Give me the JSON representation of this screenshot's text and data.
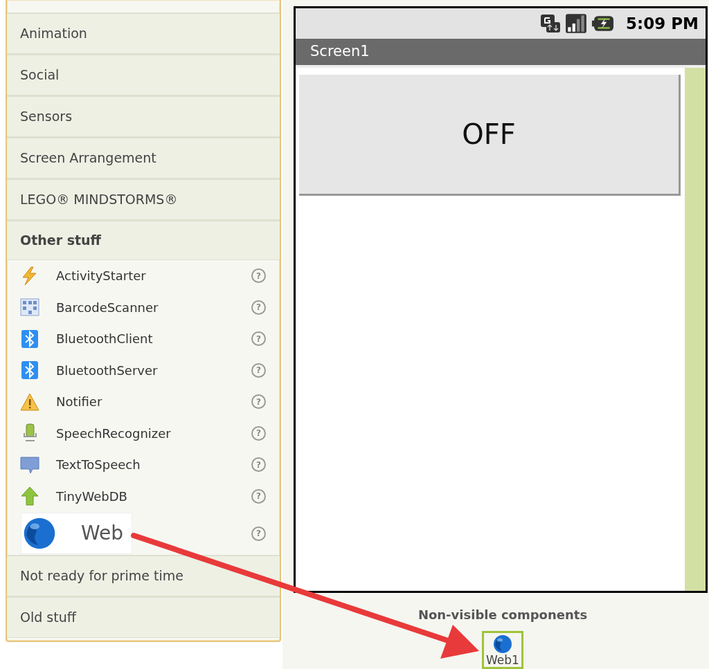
{
  "palette": {
    "categories": [
      {
        "label": "Animation",
        "expanded": false
      },
      {
        "label": "Social",
        "expanded": false
      },
      {
        "label": "Sensors",
        "expanded": false
      },
      {
        "label": "Screen Arrangement",
        "expanded": false
      },
      {
        "label": "LEGO® MINDSTORMS®",
        "expanded": false
      },
      {
        "label": "Other stuff",
        "expanded": true,
        "items": [
          {
            "kind": "bolt",
            "label": "ActivityStarter",
            "help": "?",
            "highlighted": false
          },
          {
            "kind": "grid",
            "label": "BarcodeScanner",
            "help": "?",
            "highlighted": false
          },
          {
            "kind": "bluetooth",
            "label": "BluetoothClient",
            "help": "?",
            "highlighted": false
          },
          {
            "kind": "bluetooth",
            "label": "BluetoothServer",
            "help": "?",
            "highlighted": false
          },
          {
            "kind": "warning",
            "label": "Notifier",
            "help": "?",
            "highlighted": false
          },
          {
            "kind": "mic",
            "label": "SpeechRecognizer",
            "help": "?",
            "highlighted": false
          },
          {
            "kind": "bubble",
            "label": "TextToSpeech",
            "help": "?",
            "highlighted": false
          },
          {
            "kind": "uparrow",
            "label": "TinyWebDB",
            "help": "?",
            "highlighted": false
          },
          {
            "kind": "globe",
            "label": "Web",
            "help": "?",
            "highlighted": true
          }
        ]
      },
      {
        "label": "Not ready for prime time",
        "expanded": false
      },
      {
        "label": "Old stuff",
        "expanded": false
      }
    ]
  },
  "phone": {
    "status_bar": {
      "time": "5:09 PM"
    },
    "title": "Screen1",
    "button": {
      "text": "OFF"
    }
  },
  "non_visible": {
    "heading": "Non-visible components",
    "components": [
      {
        "kind": "globe",
        "label": "Web1",
        "selected": true
      }
    ]
  }
}
